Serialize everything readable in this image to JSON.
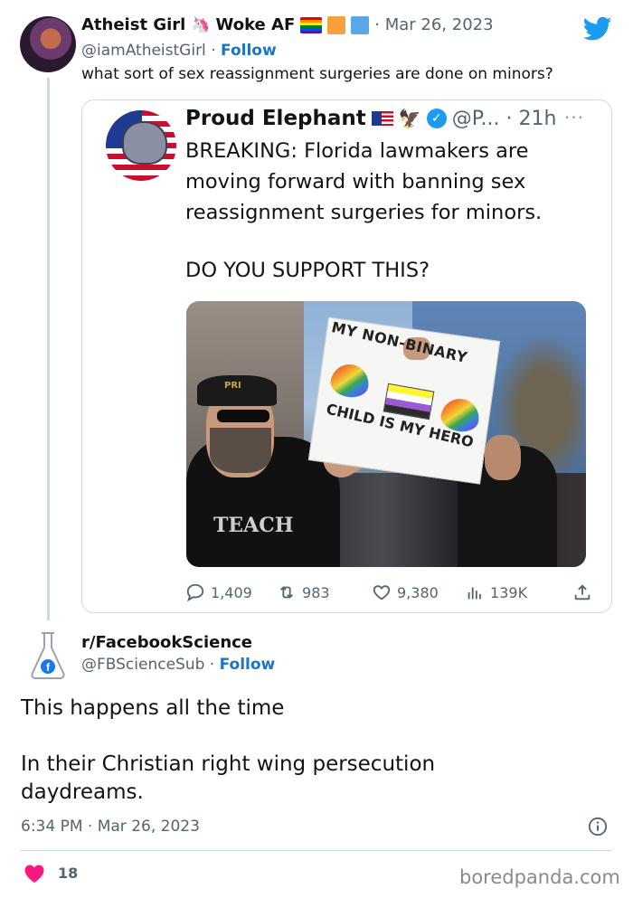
{
  "tweet": {
    "author_name": "Atheist Girl",
    "author_tag": "Woke AF",
    "date": "· Mar 26, 2023",
    "handle": "@iamAtheistGirl",
    "follow_sep": " · ",
    "follow_label": "Follow",
    "text": "what sort of sex reassignment surgeries are done on minors?",
    "icons": [
      "avatar",
      "unicorn-emoji",
      "rainbow-flag-emoji",
      "orange-square-emoji",
      "blue-square-emoji",
      "twitter-bird-icon"
    ]
  },
  "quoted": {
    "author_name": "Proud Elephant",
    "handle_time": "@P... · 21h",
    "more": "···",
    "text": "BREAKING: Florida lawmakers are moving forward with banning sex reassignment surgeries for minors.",
    "question": "DO YOU SUPPORT THIS?",
    "image": {
      "sign_line1": "MY NON-BINARY",
      "sign_line2": "CHILD IS MY HERO",
      "cap_text": "PRI",
      "shirt_text": "TEACH"
    },
    "actions": {
      "replies": "1,409",
      "retweets": "983",
      "likes": "9,380",
      "views": "139K"
    },
    "colors": {
      "verified": "#1d9bf0",
      "muted": "#536471"
    }
  },
  "reply": {
    "author_name": "r/FacebookScience",
    "handle": "@FBScienceSub",
    "follow_sep": " · ",
    "follow_label": "Follow",
    "line1": "This happens all the time",
    "line2": "In their Christian right wing persecution daydreams.",
    "timestamp": "6:34 PM · Mar 26, 2023",
    "like_count": "18",
    "colors": {
      "like": "#f91880",
      "link": "#1d74c4"
    }
  },
  "watermark": "boredpanda.com"
}
